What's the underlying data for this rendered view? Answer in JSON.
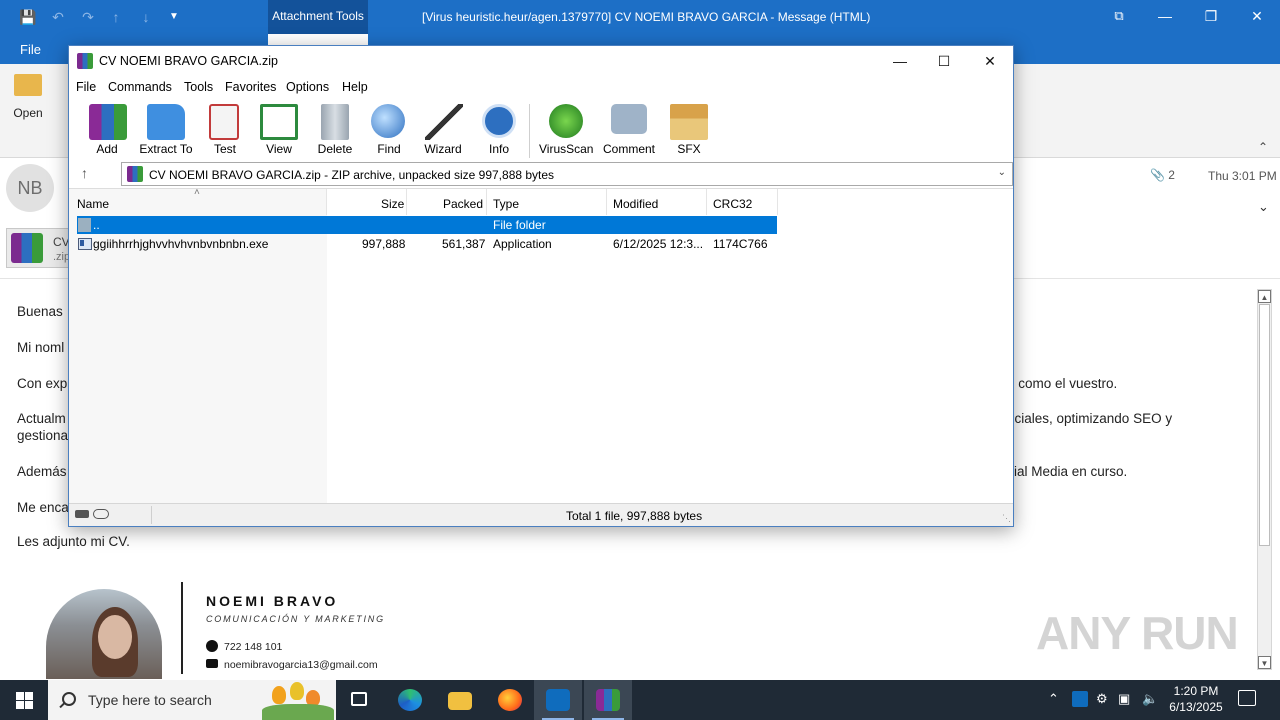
{
  "outlook": {
    "window_title": "[Virus heuristic.heur/agen.1379770] CV NOEMI BRAVO GARCIA  -  Message (HTML)",
    "context_tab": "Attachment Tools",
    "file_tab": "File",
    "open_label": "Open",
    "sender_initials": "NB",
    "attachment_count": "2",
    "received_time": "Thu 3:01 PM",
    "attachment_chip": {
      "name": "CV",
      "ext": ".zip"
    },
    "body_lines": [
      "Buenas",
      "Mi noml",
      "Con exp",
      "Actualm",
      "gestiona",
      "Además",
      "Me enca",
      "Les adjunto mi CV."
    ],
    "body_right_fragments": [
      "o como el vuestro.",
      "ociales, optimizando SEO y",
      "ial Media en curso."
    ],
    "signature": {
      "name": "NOEMI BRAVO",
      "role": "COMUNICACIÓN Y MARKETING",
      "phone": "722 148 101",
      "email": "noemibravogarcia13@gmail.com"
    },
    "watermark": "ANY RUN"
  },
  "winrar": {
    "title": "CV NOEMI BRAVO GARCIA.zip",
    "menu": [
      "File",
      "Commands",
      "Tools",
      "Favorites",
      "Options",
      "Help"
    ],
    "toolbar": [
      {
        "label": "Add",
        "icon": "add-archive-icon"
      },
      {
        "label": "Extract To",
        "icon": "extract-folder-icon"
      },
      {
        "label": "Test",
        "icon": "test-clipboard-icon"
      },
      {
        "label": "View",
        "icon": "view-book-icon"
      },
      {
        "label": "Delete",
        "icon": "trash-icon"
      },
      {
        "label": "Find",
        "icon": "magnifier-icon"
      },
      {
        "label": "Wizard",
        "icon": "wand-icon"
      },
      {
        "label": "Info",
        "icon": "info-icon"
      },
      {
        "label": "VirusScan",
        "icon": "bug-scan-icon"
      },
      {
        "label": "Comment",
        "icon": "comment-icon"
      },
      {
        "label": "SFX",
        "icon": "sfx-box-icon"
      }
    ],
    "address": "CV NOEMI BRAVO GARCIA.zip - ZIP archive, unpacked size 997,888 bytes",
    "columns": [
      "Name",
      "Size",
      "Packed",
      "Type",
      "Modified",
      "CRC32"
    ],
    "rows": [
      {
        "name": "..",
        "size": "",
        "packed": "",
        "type": "File folder",
        "modified": "",
        "crc": ""
      },
      {
        "name": "ggiihhrrhjghvvhvhvnbvnbnbn.exe",
        "size": "997,888",
        "packed": "561,387",
        "type": "Application",
        "modified": "6/12/2025 12:3...",
        "crc": "1174C766"
      }
    ],
    "status": "Total 1 file, 997,888 bytes"
  },
  "taskbar": {
    "search_placeholder": "Type here to search",
    "time": "1:20 PM",
    "date": "6/13/2025"
  }
}
